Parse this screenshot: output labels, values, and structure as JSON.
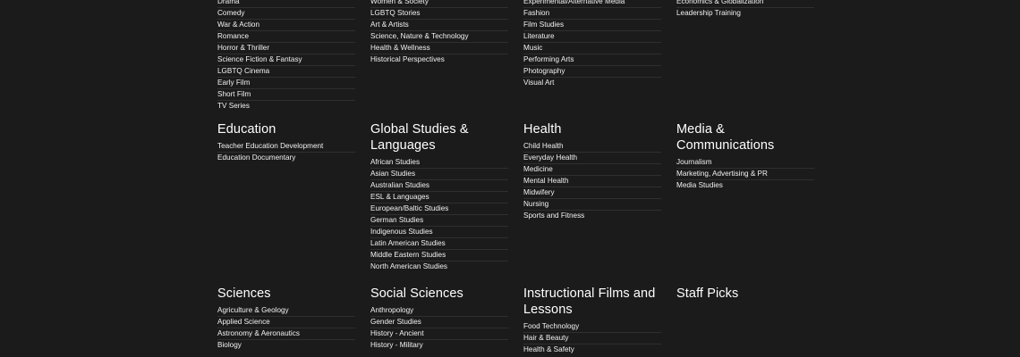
{
  "row1": {
    "col1": {
      "items": [
        "Drama",
        "Comedy",
        "War & Action",
        "Romance",
        "Horror & Thriller",
        "Science Fiction & Fantasy",
        "LGBTQ Cinema",
        "Early Film",
        "Short Film",
        "TV Series"
      ]
    },
    "col2": {
      "items": [
        "Women & Society",
        "LGBTQ Stories",
        "Art & Artists",
        "Science, Nature & Technology",
        "Health & Wellness",
        "Historical Perspectives"
      ]
    },
    "col3": {
      "items": [
        "Experimental/Alternative Media",
        "Fashion",
        "Film Studies",
        "Literature",
        "Music",
        "Performing Arts",
        "Photography",
        "Visual Art"
      ]
    },
    "col4": {
      "items": [
        "Economics & Globalization",
        "Leadership Training"
      ]
    }
  },
  "row2": {
    "col1": {
      "title": "Education",
      "items": [
        "Teacher Education Development",
        "Education Documentary"
      ]
    },
    "col2": {
      "title_line1": "Global Studies &",
      "title_line2": "Languages",
      "items": [
        "African Studies",
        "Asian Studies",
        "Australian Studies",
        "ESL & Languages",
        "European/Baltic Studies",
        "German Studies",
        "Indigenous Studies",
        "Latin American Studies",
        "Middle Eastern Studies",
        "North American Studies"
      ]
    },
    "col3": {
      "title": "Health",
      "items": [
        "Child Health",
        "Everyday Health",
        "Medicine",
        "Mental Health",
        "Midwifery",
        "Nursing",
        "Sports and Fitness"
      ]
    },
    "col4": {
      "title_line1": "Media &",
      "title_line2": "Communications",
      "items": [
        "Journalism",
        "Marketing, Advertising & PR",
        "Media Studies"
      ]
    }
  },
  "row3": {
    "col1": {
      "title": "Sciences",
      "items": [
        "Agriculture & Geology",
        "Applied Science",
        "Astronomy & Aeronautics",
        "Biology"
      ]
    },
    "col2": {
      "title": "Social Sciences",
      "items": [
        "Anthropology",
        "Gender Studies",
        "History - Ancient",
        "History - Military"
      ]
    },
    "col3": {
      "title_line1": "Instructional Films and",
      "title_line2": "Lessons",
      "items": [
        "Food Technology",
        "Hair & Beauty",
        "Health & Safety"
      ]
    },
    "col4": {
      "title": "Staff Picks"
    }
  }
}
